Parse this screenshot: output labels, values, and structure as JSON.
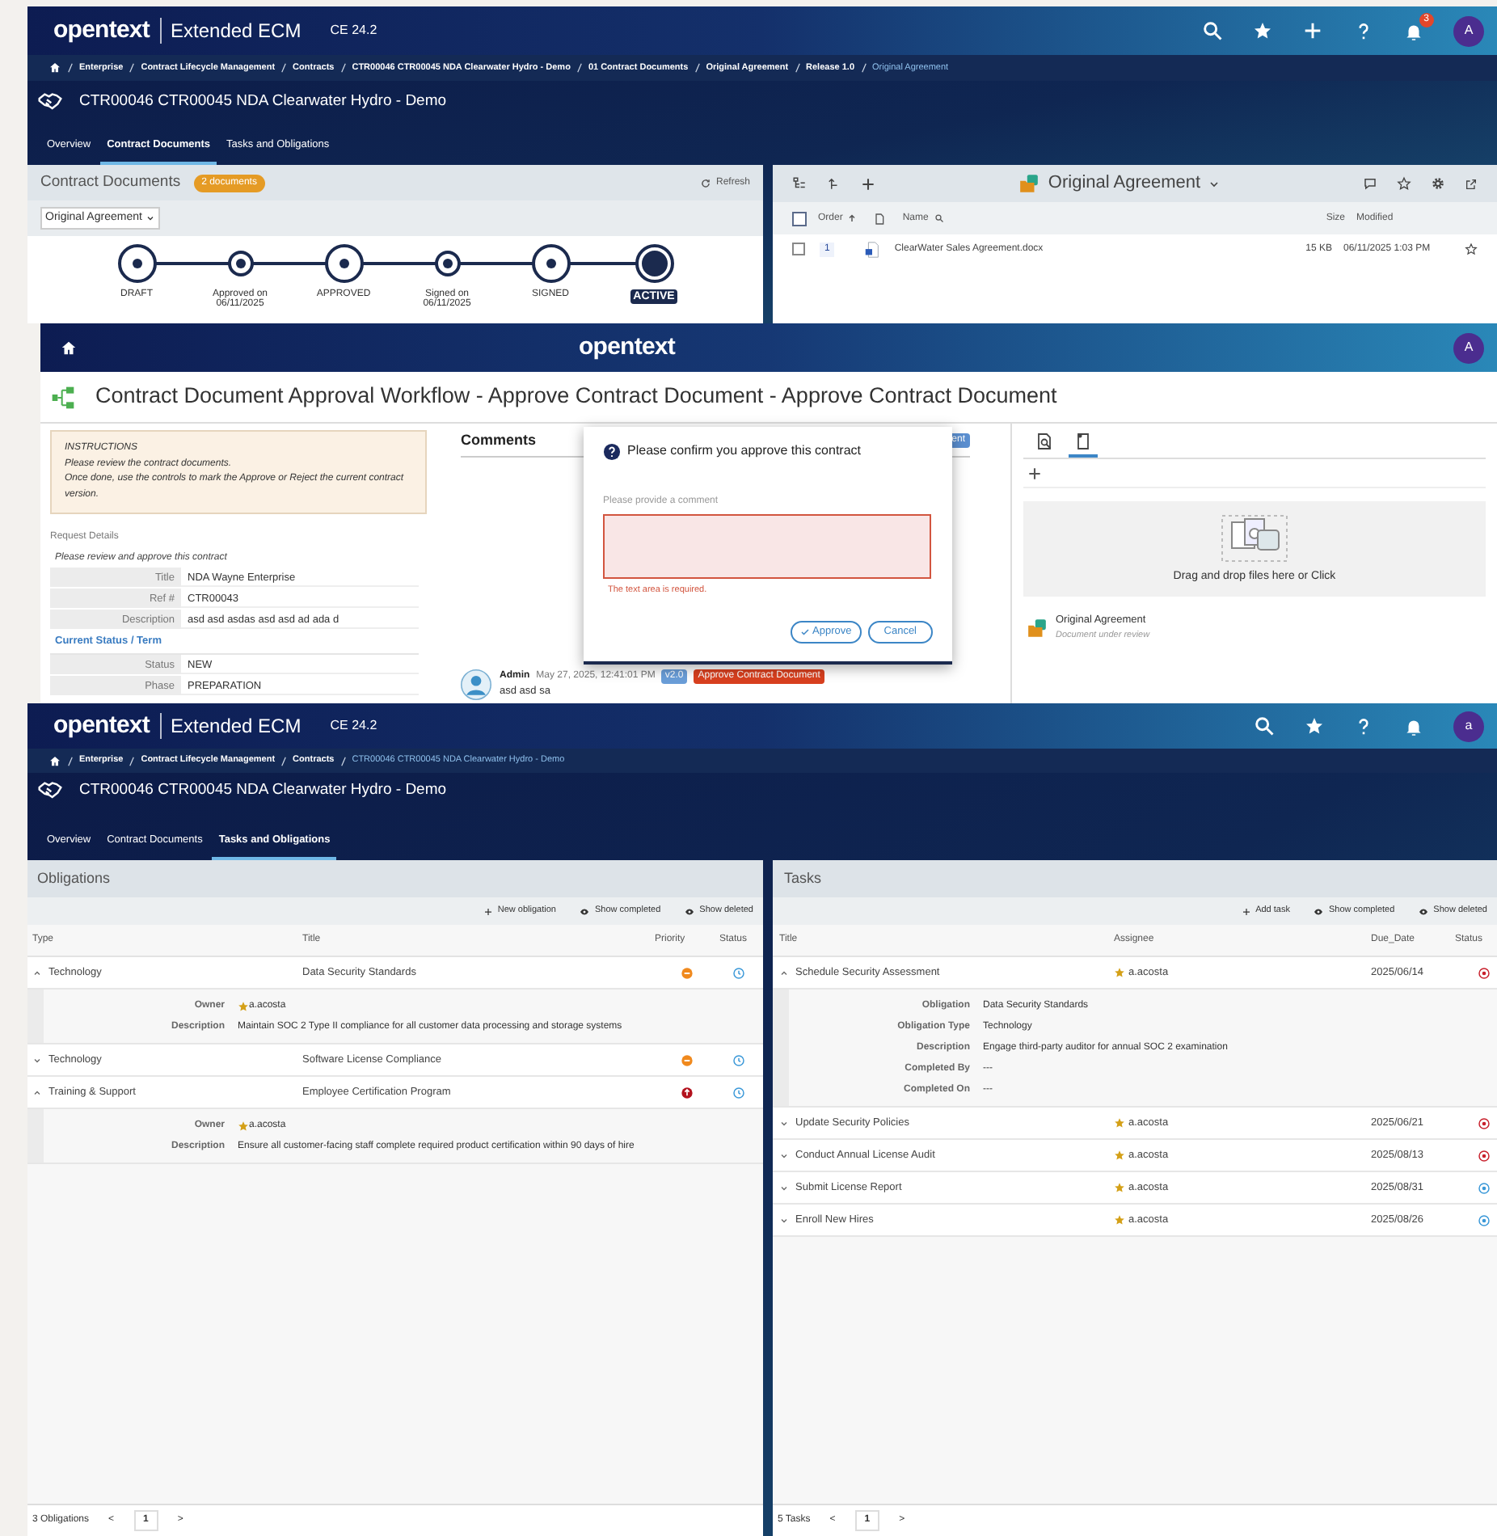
{
  "screen_1": {
    "header": {
      "logo": "opentext",
      "product": "Extended ECM",
      "version": "CE 24.2",
      "notification_count": "3",
      "avatar": "A"
    },
    "breadcrumb": [
      {
        "label": "Enterprise",
        "current": false
      },
      {
        "label": "Contract Lifecycle Management",
        "current": false
      },
      {
        "label": "Contracts",
        "current": false
      },
      {
        "label": "CTR00046 CTR00045 NDA Clearwater Hydro - Demo",
        "current": false
      },
      {
        "label": "01 Contract Documents",
        "current": false
      },
      {
        "label": "Original Agreement",
        "current": false
      },
      {
        "label": "Release 1.0",
        "current": false
      },
      {
        "label": "Original Agreement",
        "current": true
      }
    ],
    "title": "CTR00046 CTR00045 NDA Clearwater Hydro - Demo",
    "tabs": [
      {
        "label": "Overview",
        "selected": false
      },
      {
        "label": "Contract Documents",
        "selected": true
      },
      {
        "label": "Tasks and Obligations",
        "selected": false
      }
    ],
    "documents_panel": {
      "title": "Contract Documents",
      "badge": "2 documents",
      "refresh": "Refresh",
      "dropdown": "Original Agreement",
      "stages": [
        {
          "label": "DRAFT",
          "kind": "major",
          "current": false
        },
        {
          "label": "Approved on 06/11/2025",
          "kind": "minor",
          "current": false
        },
        {
          "label": "APPROVED",
          "kind": "major",
          "current": false
        },
        {
          "label": "Signed on 06/11/2025",
          "kind": "minor",
          "current": false
        },
        {
          "label": "SIGNED",
          "kind": "major",
          "current": false
        },
        {
          "label": "ACTIVE",
          "kind": "major",
          "current": true
        }
      ]
    },
    "folder_panel": {
      "title": "Original Agreement",
      "select_all": {
        "checked": false
      },
      "columns": [
        "Order",
        "Name",
        "Size",
        "Modified"
      ],
      "rows": [
        {
          "checked": false,
          "order": "1",
          "name": "ClearWater Sales Agreement.docx",
          "size": "15 KB",
          "modified": "06/11/2025 1:03 PM"
        }
      ]
    }
  },
  "screen_2": {
    "logo": "opentext",
    "avatar": "A",
    "title": "Contract Document Approval Workflow - Approve Contract Document - Approve Contract Document",
    "instructions": {
      "heading": "INSTRUCTIONS",
      "lines": [
        "Please review the contract documents.",
        "Once done, use the controls to mark the Approve or Reject the current contract version."
      ]
    },
    "request_details": {
      "label": "Request Details",
      "note": "Please review and approve this contract",
      "rows": [
        {
          "kind": "field",
          "label": "Title",
          "value": "NDA Wayne Enterprise"
        },
        {
          "kind": "field",
          "label": "Ref #",
          "value": "CTR00043"
        },
        {
          "kind": "field",
          "label": "Description",
          "value": "asd asd asdas asd asd ad ada d"
        },
        {
          "kind": "section",
          "label": "Current Status / Term"
        },
        {
          "kind": "field",
          "label": "Status",
          "value": "NEW"
        },
        {
          "kind": "field",
          "label": "Phase",
          "value": "PREPARATION"
        }
      ]
    },
    "comments": {
      "heading": "Comments",
      "chip": "ent",
      "entries": [
        {
          "author": "Admin",
          "date": "May 27, 2025, 12:41:01 PM",
          "version": "v2.0",
          "tag": "Approve Contract Document",
          "text": "asd asd sa"
        }
      ]
    },
    "dialog": {
      "title": "Please confirm you approve this contract",
      "field_label": "Please provide a comment",
      "error": "The text area is required.",
      "approve": "Approve",
      "cancel": "Cancel"
    },
    "attachments": {
      "tabs": [
        {
          "kind": "preview",
          "selected": false
        },
        {
          "kind": "document",
          "selected": true
        }
      ],
      "drop_text": "Drag and drop files here or Click",
      "items": [
        {
          "name": "Original Agreement",
          "note": "Document under review"
        }
      ]
    }
  },
  "screen_3": {
    "header": {
      "logo": "opentext",
      "product": "Extended ECM",
      "version": "CE 24.2",
      "avatar": "a"
    },
    "breadcrumb": [
      {
        "label": "Enterprise",
        "current": false
      },
      {
        "label": "Contract Lifecycle Management",
        "current": false
      },
      {
        "label": "Contracts",
        "current": false
      },
      {
        "label": "CTR00046 CTR00045 NDA Clearwater Hydro - Demo",
        "current": true
      }
    ],
    "title": "CTR00046 CTR00045 NDA Clearwater Hydro - Demo",
    "tabs": [
      {
        "label": "Overview",
        "selected": false
      },
      {
        "label": "Contract Documents",
        "selected": false
      },
      {
        "label": "Tasks and Obligations",
        "selected": true
      }
    ],
    "obligations": {
      "title": "Obligations",
      "actions": [
        {
          "kind": "add",
          "label": "New obligation"
        },
        {
          "kind": "view",
          "label": "Show completed"
        },
        {
          "kind": "view",
          "label": "Show deleted"
        }
      ],
      "columns": [
        "Type",
        "Title",
        "Priority",
        "Status"
      ],
      "rows": [
        {
          "type": "Technology",
          "title": "Data Security Standards",
          "high_priority": false,
          "expanded": true,
          "details": [
            {
              "label": "Owner",
              "value": "a.acosta",
              "kind": "user"
            },
            {
              "label": "Description",
              "value": "Maintain SOC 2 Type II compliance for all customer data processing and storage systems",
              "kind": "text"
            }
          ]
        },
        {
          "type": "Technology",
          "title": "Software License Compliance",
          "high_priority": false,
          "expanded": false
        },
        {
          "type": "Training & Support",
          "title": "Employee Certification Program",
          "high_priority": true,
          "expanded": true,
          "details": [
            {
              "label": "Owner",
              "value": "a.acosta",
              "kind": "user"
            },
            {
              "label": "Description",
              "value": "Ensure all customer-facing staff complete required product certification within 90 days of hire",
              "kind": "text"
            }
          ]
        }
      ],
      "footer": {
        "count": "3 Obligations",
        "prev": "<",
        "page": "1",
        "next": ">"
      }
    },
    "tasks": {
      "title": "Tasks",
      "actions": [
        {
          "kind": "add",
          "label": "Add task"
        },
        {
          "kind": "view",
          "label": "Show completed"
        },
        {
          "kind": "view",
          "label": "Show deleted"
        }
      ],
      "columns": [
        "Title",
        "Assignee",
        "Due_Date",
        "Status"
      ],
      "rows": [
        {
          "title": "Schedule Security Assessment",
          "assignee": "a.acosta",
          "due_date": "2025/06/14",
          "overdue": true,
          "expanded": true,
          "details": [
            {
              "label": "Obligation",
              "value": "Data Security Standards"
            },
            {
              "label": "Obligation Type",
              "value": "Technology"
            },
            {
              "label": "Description",
              "value": "Engage third-party auditor for annual SOC 2 examination"
            },
            {
              "label": "Completed By",
              "value": "---"
            },
            {
              "label": "Completed On",
              "value": "---"
            }
          ]
        },
        {
          "title": "Update Security Policies",
          "assignee": "a.acosta",
          "due_date": "2025/06/21",
          "overdue": true,
          "expanded": false
        },
        {
          "title": "Conduct Annual License Audit",
          "assignee": "a.acosta",
          "due_date": "2025/08/13",
          "overdue": true,
          "expanded": false
        },
        {
          "title": "Submit License Report",
          "assignee": "a.acosta",
          "due_date": "2025/08/31",
          "overdue": false,
          "expanded": false
        },
        {
          "title": "Enroll New Hires",
          "assignee": "a.acosta",
          "due_date": "2025/08/26",
          "overdue": false,
          "expanded": false
        }
      ],
      "footer": {
        "count": "5 Tasks",
        "prev": "<",
        "page": "1",
        "next": ">"
      }
    }
  }
}
